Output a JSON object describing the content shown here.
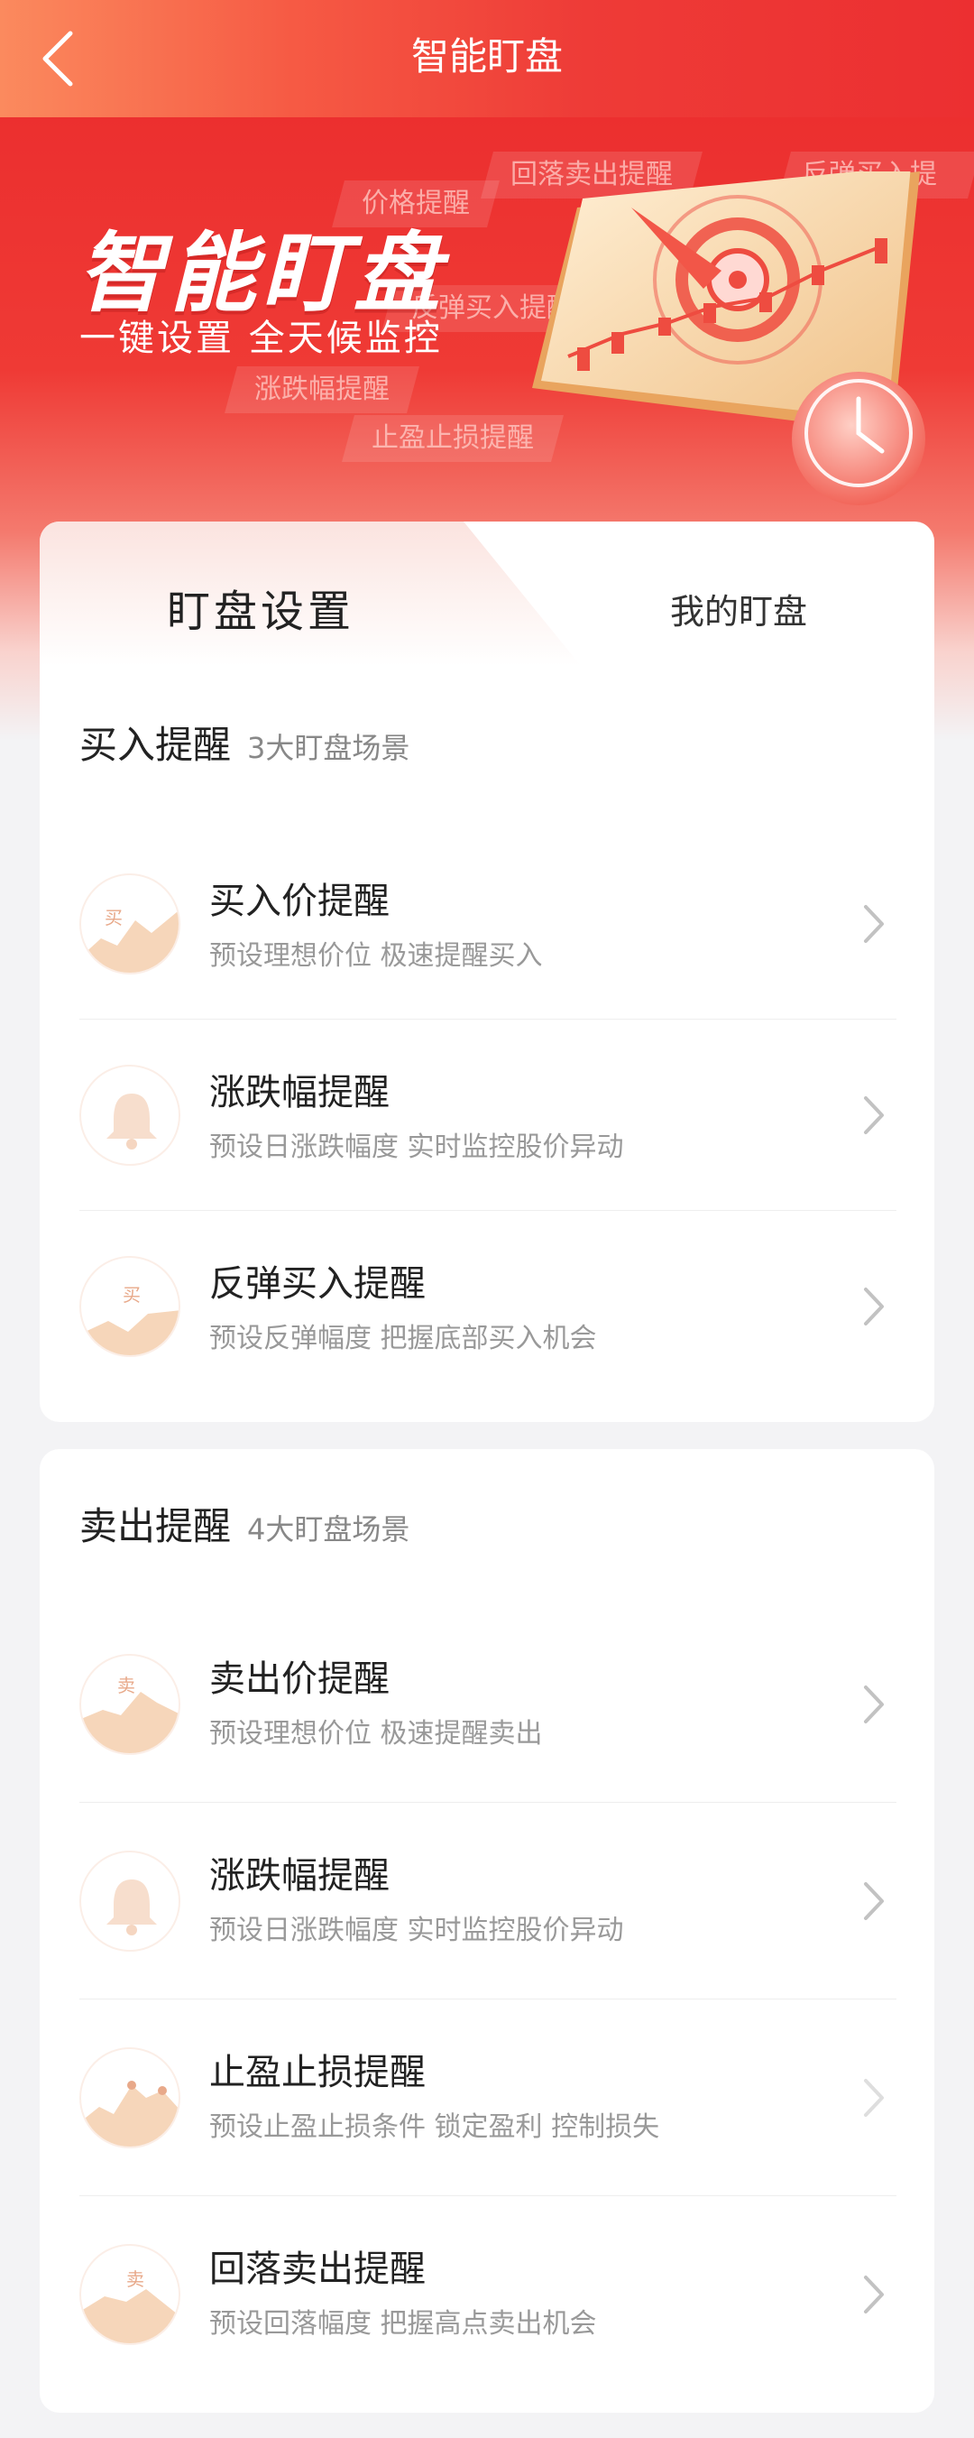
{
  "header": {
    "title": "智能盯盘"
  },
  "banner": {
    "title": "智能盯盘",
    "subtitle": "一键设置  全天候监控",
    "tags": [
      "价格提醒",
      "回落卖出提醒",
      "反弹买入提醒",
      "反弹买入提醒",
      "涨跌幅提醒",
      "止盈止损提醒"
    ]
  },
  "tabs": {
    "settings": "盯盘设置",
    "mine": "我的盯盘"
  },
  "buy": {
    "title": "买入提醒",
    "subtitle": "3大盯盘场景",
    "items": [
      {
        "title": "买入价提醒",
        "desc": "预设理想价位 极速提醒买入",
        "icon": "buy-price-icon",
        "glyph": "买"
      },
      {
        "title": "涨跌幅提醒",
        "desc": "预设日涨跌幅度 实时监控股价异动",
        "icon": "bell-icon",
        "glyph": ""
      },
      {
        "title": "反弹买入提醒",
        "desc": "预设反弹幅度 把握底部买入机会",
        "icon": "rebound-buy-icon",
        "glyph": "买"
      }
    ]
  },
  "sell": {
    "title": "卖出提醒",
    "subtitle": "4大盯盘场景",
    "items": [
      {
        "title": "卖出价提醒",
        "desc": "预设理想价位 极速提醒卖出",
        "icon": "sell-price-icon",
        "glyph": "卖"
      },
      {
        "title": "涨跌幅提醒",
        "desc": "预设日涨跌幅度 实时监控股价异动",
        "icon": "bell-icon",
        "glyph": ""
      },
      {
        "title": "止盈止损提醒",
        "desc": "预设止盈止损条件 锁定盈利 控制损失",
        "icon": "stop-profit-loss-icon",
        "glyph": ""
      },
      {
        "title": "回落卖出提醒",
        "desc": "预设回落幅度 把握高点卖出机会",
        "icon": "pullback-sell-icon",
        "glyph": "卖"
      }
    ]
  },
  "colors": {
    "brand_red": "#ec2f31",
    "accent_orange": "#fb8a5e",
    "icon_tint": "#f0c4a8"
  }
}
